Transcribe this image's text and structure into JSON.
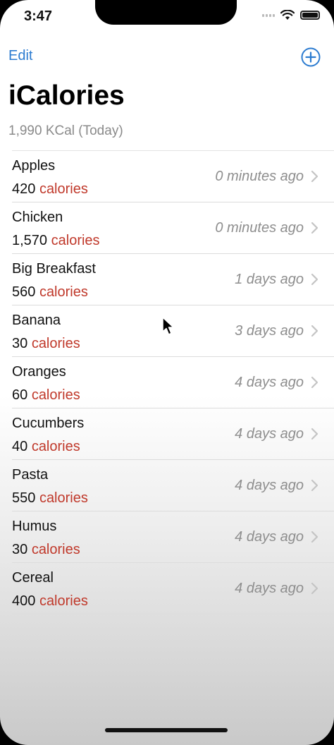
{
  "status_bar": {
    "time": "3:47"
  },
  "nav": {
    "edit_label": "Edit"
  },
  "header": {
    "title": "iCalories",
    "subtitle": "1,990 KCal (Today)"
  },
  "colors": {
    "accent": "#2b7bd0",
    "calories_unit": "#c0392b"
  },
  "icons": {
    "add": "plus-circle-icon",
    "disclosure": "chevron-right-icon"
  },
  "items": [
    {
      "name": "Apples",
      "calories": "420",
      "unit": "calories",
      "time": "0 minutes ago"
    },
    {
      "name": "Chicken",
      "calories": "1,570",
      "unit": "calories",
      "time": "0 minutes ago"
    },
    {
      "name": "Big Breakfast",
      "calories": "560",
      "unit": "calories",
      "time": "1 days ago"
    },
    {
      "name": "Banana",
      "calories": "30",
      "unit": "calories",
      "time": "3 days ago"
    },
    {
      "name": "Oranges",
      "calories": "60",
      "unit": "calories",
      "time": "4 days ago"
    },
    {
      "name": "Cucumbers",
      "calories": "40",
      "unit": "calories",
      "time": "4 days ago"
    },
    {
      "name": "Pasta",
      "calories": "550",
      "unit": "calories",
      "time": "4 days ago"
    },
    {
      "name": "Humus",
      "calories": "30",
      "unit": "calories",
      "time": "4 days ago"
    },
    {
      "name": "Cereal",
      "calories": "400",
      "unit": "calories",
      "time": "4 days ago"
    }
  ]
}
